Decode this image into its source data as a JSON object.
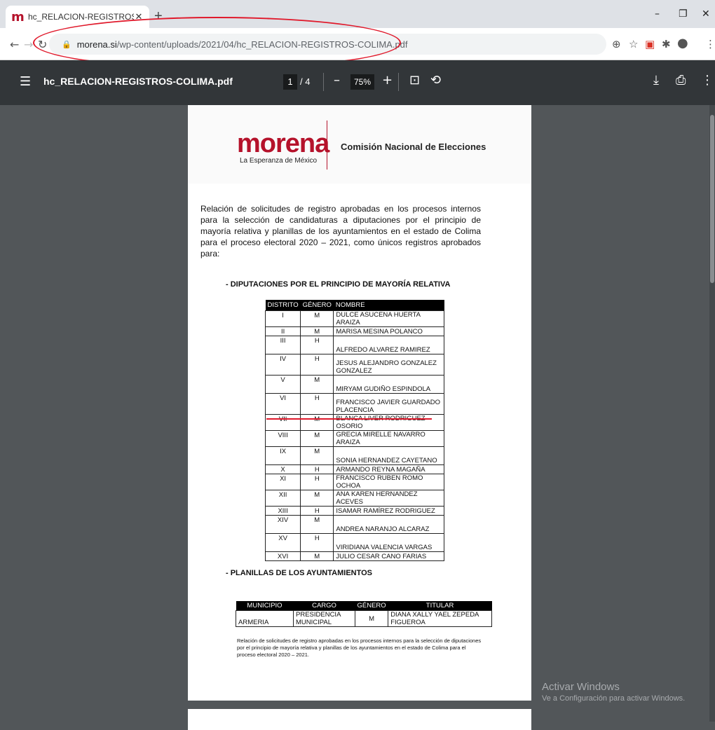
{
  "browser": {
    "tab_title": "hc_RELACION-REGISTROS-COLIMA.pdf",
    "tab_favicon": "m",
    "new_tab": "+",
    "url_host": "morena.si",
    "url_path": "/wp-content/uploads/2021/04/hc_RELACION-REGISTROS-COLIMA.pdf",
    "accent_color": "#e0192b"
  },
  "pdf_toolbar": {
    "filename": "hc_RELACION-REGISTROS-COLIMA.pdf",
    "current_page": "1",
    "total_pages": "/ 4",
    "zoom": "75%"
  },
  "document": {
    "logo_text": "morena",
    "slogan": "La Esperanza de México",
    "commission": "Comisión Nacional de Elecciones",
    "intro": "Relación de solicitudes de registro aprobadas en los procesos internos para la selección de candidaturas a diputaciones por el principio de mayoría relativa y planillas de los ayuntamientos en el estado de Colima para el proceso electoral 2020 – 2021, como únicos registros aprobados para:",
    "section1": "-   DIPUTACIONES POR EL PRINCIPIO DE MAYORÍA RELATIVA",
    "section2": "-   PLANILLAS DE LOS AYUNTAMIENTOS",
    "table1_headers": [
      "DISTRITO",
      "GÉNERO",
      "NOMBRE"
    ],
    "table1_rows": [
      [
        "I",
        "M",
        "DULCE ASUCENA HUERTA ARAIZA"
      ],
      [
        "II",
        "M",
        "MARISA MESINA POLANCO"
      ],
      [
        "III",
        "H",
        "ALFREDO ALVAREZ RAMIREZ"
      ],
      [
        "IV",
        "H",
        "JESUS ALEJANDRO GONZALEZ GONZALEZ"
      ],
      [
        "V",
        "M",
        "MIRYAM GUDIÑO ESPINDOLA"
      ],
      [
        "VI",
        "H",
        "FRANCISCO JAVIER GUARDADO PLACENCIA"
      ],
      [
        "VII",
        "M",
        "BLANCA LIVER RODRIGUEZ OSORIO"
      ],
      [
        "VIII",
        "M",
        "GRECIA MIRELLE NAVARRO ARAIZA"
      ],
      [
        "IX",
        "M",
        "SONIA HERNANDEZ CAYETANO"
      ],
      [
        "X",
        "H",
        "ARMANDO REYNA MAGAÑA"
      ],
      [
        "XI",
        "H",
        "FRANCISCO RUBEN ROMO OCHOA"
      ],
      [
        "XII",
        "M",
        "ANA KAREN HERNANDEZ ACEVES"
      ],
      [
        "XIII",
        "H",
        "ISAMAR RAMÍREZ RODRIGUEZ"
      ],
      [
        "XIV",
        "M",
        "ANDREA NARANJO ALCARAZ"
      ],
      [
        "XV",
        "H",
        "VIRIDIANA VALENCIA VARGAS"
      ],
      [
        "XVI",
        "M",
        "JULIO CESAR CANO FARIAS"
      ]
    ],
    "table2_headers": [
      "MUNICIPIO",
      "CARGO",
      "GÉNERO",
      "TITULAR"
    ],
    "table2_rows": [
      [
        "ARMERIA",
        "PRESIDENCIA MUNICIPAL",
        "M",
        "DIANA XALLY YAEL ZEPEDA FIGUEROA"
      ]
    ],
    "footnote": "Relación de solicitudes de registro aprobadas en los procesos internos para la selección de diputaciones por el principio de mayoría relativa y planillas de los ayuntamientos en el estado de Colima para el proceso electoral 2020 – 2021."
  },
  "watermark": {
    "line1": "Activar Windows",
    "line2": "Ve a Configuración para activar Windows."
  }
}
